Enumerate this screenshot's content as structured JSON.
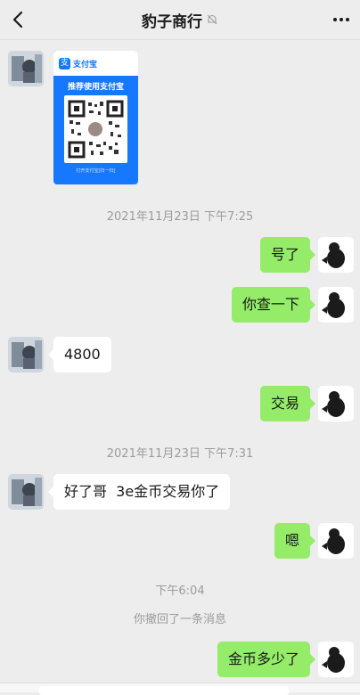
{
  "header": {
    "title": "豹子商行",
    "back_icon": "chevron-left-icon",
    "mute_icon": "bell-muted-icon",
    "more_icon": "more-dots-icon"
  },
  "alipay_card": {
    "brand": "支付宝",
    "slogan": "推荐使用支付宝",
    "hint": "打开支付宝[扫一扫]"
  },
  "messages": {
    "ts1": "2021年11月23日 下午7:25",
    "m1": "号了",
    "m2": "你查一下",
    "m3": "4800",
    "m4": "交易",
    "ts2": "2021年11月23日 下午7:31",
    "m5": "好了哥  3e金币交易你了",
    "m6": "嗯",
    "ts3": "下午6:04",
    "recall": "你撤回了一条消息",
    "m7": "金币多少了"
  },
  "colors": {
    "background": "#ededed",
    "bubble_self": "#95ec69",
    "bubble_other": "#ffffff",
    "alipay_blue": "#1677ff"
  }
}
